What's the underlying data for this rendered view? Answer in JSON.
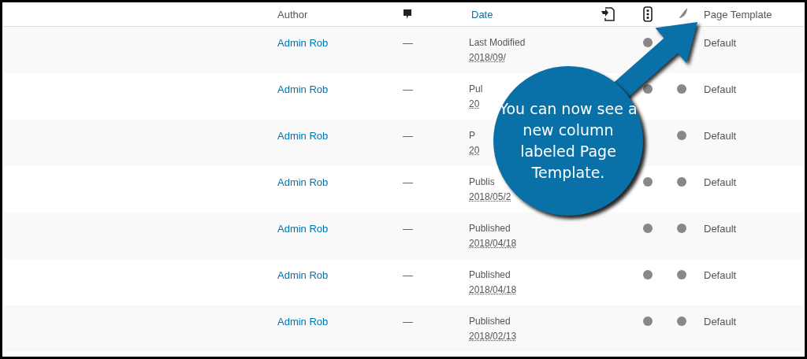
{
  "table": {
    "columns": [
      {
        "kind": "text",
        "label": "Author"
      },
      {
        "kind": "comment_icon"
      },
      {
        "kind": "link",
        "label": "Date"
      },
      {
        "kind": "document_icon"
      },
      {
        "kind": "lights_icon"
      },
      {
        "kind": "feather_icon"
      },
      {
        "kind": "text",
        "label": "Page Template"
      }
    ],
    "rows": [
      {
        "author": "Admin Rob",
        "comments": "—",
        "status": "Last Modified",
        "date": "2018/09/",
        "dots": [
          {
            "kind": "dot"
          },
          {
            "kind": "blank"
          }
        ],
        "template": "Default"
      },
      {
        "author": "Admin Rob",
        "comments": "—",
        "status": "Pul",
        "date": "20",
        "dots": [
          {
            "kind": "dot"
          },
          {
            "kind": "dot"
          }
        ],
        "template": "Default"
      },
      {
        "author": "Admin Rob",
        "comments": "—",
        "status": "P",
        "date": "20",
        "dots": [
          {
            "kind": "blank"
          },
          {
            "kind": "dot"
          }
        ],
        "template": "Default"
      },
      {
        "author": "Admin Rob",
        "comments": "—",
        "status": "Publis",
        "date": "2018/05/2",
        "dots": [
          {
            "kind": "dot"
          },
          {
            "kind": "dot"
          }
        ],
        "template": "Default"
      },
      {
        "author": "Admin Rob",
        "comments": "—",
        "status": "Published",
        "date": "2018/04/18",
        "dots": [
          {
            "kind": "dot"
          },
          {
            "kind": "dot"
          }
        ],
        "template": "Default"
      },
      {
        "author": "Admin Rob",
        "comments": "—",
        "status": "Published",
        "date": "2018/04/18",
        "dots": [
          {
            "kind": "dot"
          },
          {
            "kind": "dot"
          }
        ],
        "template": "Default"
      },
      {
        "author": "Admin Rob",
        "comments": "—",
        "status": "Published",
        "date": "2018/02/13",
        "dots": [
          {
            "kind": "dot"
          },
          {
            "kind": "dot"
          }
        ],
        "template": "Default"
      }
    ]
  },
  "callout": {
    "text": "You can now see a new column labeled Page Template."
  }
}
